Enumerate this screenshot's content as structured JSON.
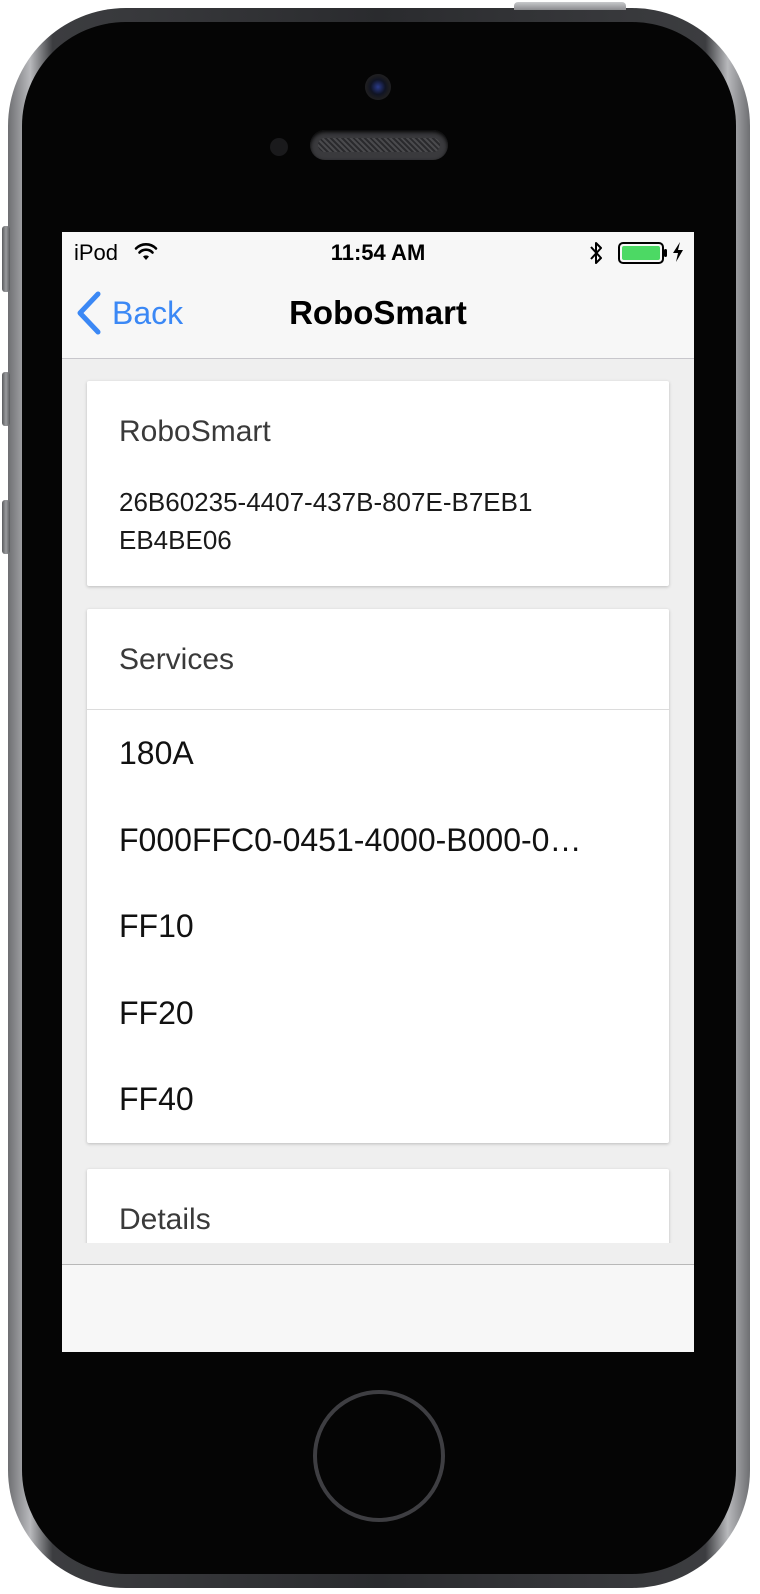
{
  "status_bar": {
    "carrier": "iPod",
    "time": "11:54 AM",
    "battery_color": "#4cd964"
  },
  "nav": {
    "back_label": "Back",
    "title": "RoboSmart",
    "tint_color": "#3b88f5"
  },
  "device_card": {
    "name": "RoboSmart",
    "uuid": "26B60235-4407-437B-807E-B7EB1EB4BE06"
  },
  "services_card": {
    "title": "Services",
    "items": [
      {
        "label": "180A"
      },
      {
        "label": "F000FFC0-0451-4000-B000-0…"
      },
      {
        "label": "FF10"
      },
      {
        "label": "FF20"
      },
      {
        "label": "FF40"
      }
    ]
  },
  "details_card": {
    "title": "Details"
  }
}
